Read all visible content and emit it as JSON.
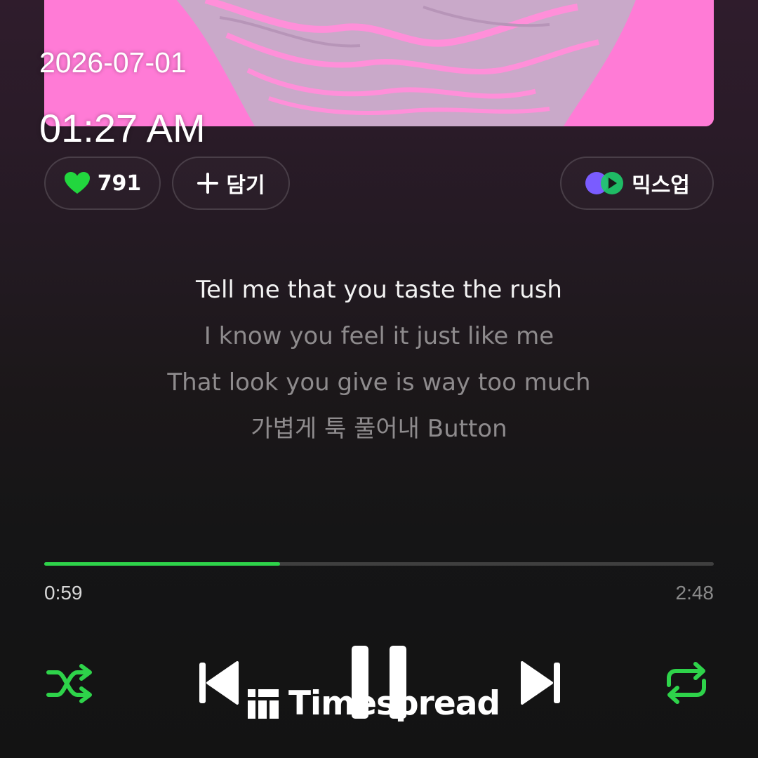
{
  "overlay": {
    "date": "2026-07-01",
    "time": "01:27 AM"
  },
  "actions": {
    "like_count": "791",
    "add_label": "담기",
    "mixup_label": "믹스업"
  },
  "lyrics": {
    "current": "Tell me that you taste the rush",
    "next": [
      "I know you feel it just like me",
      "That look you give is way too much",
      "가볍게 툭 풀어내 Button"
    ]
  },
  "playback": {
    "elapsed": "0:59",
    "total": "2:48",
    "progress_fraction": 0.352,
    "state": "playing"
  },
  "controls": {
    "shuffle_icon": "shuffle-icon",
    "prev_icon": "previous-icon",
    "pause_icon": "pause-icon",
    "next_icon": "next-icon",
    "repeat_icon": "repeat-icon"
  },
  "watermark": {
    "text": "Timespread"
  },
  "colors": {
    "accent": "#2ed34a",
    "heart": "#22d63e",
    "album_pink": "#ff7bd6",
    "background_top": "#2f1c2c",
    "background_bottom": "#131313"
  }
}
